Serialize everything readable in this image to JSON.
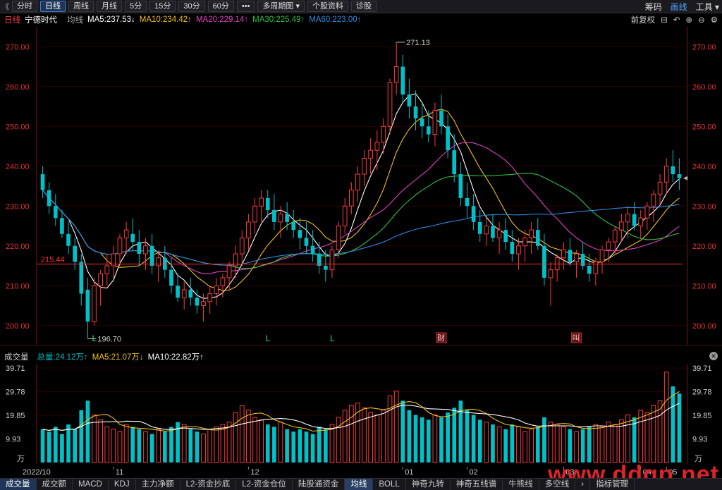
{
  "toolbar": {
    "back_glyph": "《",
    "buttons": [
      "分时",
      "日线",
      "周线",
      "月线",
      "5分",
      "15分",
      "30分",
      "60分",
      "•••",
      "多周期图 ▾",
      "个股资料",
      "诊股"
    ],
    "active_index": 1,
    "right": [
      "筹码",
      "画线",
      "工具 ▾"
    ]
  },
  "legend": {
    "period": "日线",
    "stock": "宁德时代",
    "avg_label": "均线",
    "ma5": "MA5:237.53↓",
    "ma10": "MA10:234.42↑",
    "ma20": "MA20:229.14↑",
    "ma30": "MA30:225.49↑",
    "ma60": "MA60:223.00↑",
    "adjust": "前复权"
  },
  "colors": {
    "up": "#ff3c3c",
    "down": "#00c0c8",
    "ma5": "#ffffff",
    "ma10": "#f0c020",
    "ma20": "#e040c0",
    "ma30": "#30c040",
    "ma60": "#2a8ae0",
    "axis_text": "#e63030",
    "grid": "#2a0000"
  },
  "price_axis": [
    "270.00",
    "260.00",
    "250.00",
    "240.00",
    "230.00",
    "220.00",
    "210.00",
    "200.00"
  ],
  "annotations": {
    "high": "271.13",
    "low": "196.70",
    "ref_line": "215.44",
    "markers": [
      "L",
      "L",
      "L"
    ],
    "finance_marker": "财",
    "q_marker": "叫"
  },
  "volume": {
    "label": "成交量",
    "total": "总量:24.12万↑",
    "ma5": "MA5:21.07万↓",
    "ma10": "MA10:22.82万↑",
    "axis": [
      "39.71",
      "29.78",
      "19.85",
      "9.93",
      "万"
    ]
  },
  "x_axis": [
    "2022/10",
    "11",
    "12",
    "01",
    "02",
    "03",
    "04",
    "05"
  ],
  "bottom_tabs": [
    "成交量",
    "成交额",
    "MACD",
    "KDJ",
    "主力净额",
    "L2-资金抄底",
    "L2-资金仓位",
    "陆股通资金",
    "均线",
    "BOLL",
    "神奇九转",
    "神奇五线谱",
    "牛熊线",
    "多空线",
    "›",
    "指标管理"
  ],
  "watermark": "www.ddgp.net",
  "chart_data": {
    "type": "candlestick",
    "title": "宁德时代 日线",
    "ylim": [
      195,
      275
    ],
    "candles": [
      [
        238,
        240,
        232,
        234
      ],
      [
        234,
        236,
        228,
        230
      ],
      [
        230,
        233,
        225,
        227
      ],
      [
        227,
        229,
        222,
        223
      ],
      [
        223,
        226,
        218,
        220
      ],
      [
        220,
        222,
        214,
        216
      ],
      [
        216,
        218,
        205,
        208
      ],
      [
        209,
        212,
        196.7,
        201
      ],
      [
        201,
        212,
        200,
        210
      ],
      [
        210,
        214,
        205,
        213
      ],
      [
        213,
        218,
        210,
        215
      ],
      [
        215,
        220,
        212,
        218
      ],
      [
        218,
        223,
        215,
        222
      ],
      [
        222,
        226,
        218,
        224
      ],
      [
        223,
        227,
        219,
        221
      ],
      [
        221,
        224,
        215,
        218
      ],
      [
        218,
        222,
        214,
        220
      ],
      [
        220,
        223,
        213,
        215
      ],
      [
        215,
        219,
        211,
        217
      ],
      [
        217,
        220,
        212,
        214
      ],
      [
        214,
        217,
        208,
        210
      ],
      [
        210,
        213,
        206,
        207
      ],
      [
        207,
        211,
        204,
        209
      ],
      [
        209,
        212,
        205,
        207
      ],
      [
        207,
        209,
        203,
        205
      ],
      [
        205,
        208,
        201,
        206
      ],
      [
        206,
        210,
        203,
        208
      ],
      [
        208,
        212,
        205,
        210
      ],
      [
        210,
        213,
        207,
        212
      ],
      [
        212,
        216,
        209,
        215
      ],
      [
        215,
        220,
        212,
        218
      ],
      [
        218,
        224,
        215,
        222
      ],
      [
        222,
        228,
        219,
        226
      ],
      [
        226,
        232,
        223,
        230
      ],
      [
        230,
        234,
        226,
        232
      ],
      [
        232,
        234,
        227,
        229
      ],
      [
        229,
        233,
        224,
        226
      ],
      [
        226,
        230,
        222,
        228
      ],
      [
        228,
        231,
        224,
        226
      ],
      [
        226,
        229,
        222,
        224
      ],
      [
        224,
        227,
        219,
        222
      ],
      [
        222,
        226,
        218,
        220
      ],
      [
        220,
        224,
        216,
        218
      ],
      [
        218,
        221,
        213,
        215
      ],
      [
        215,
        219,
        211,
        214
      ],
      [
        214,
        220,
        212,
        219
      ],
      [
        219,
        226,
        217,
        225
      ],
      [
        225,
        232,
        223,
        230
      ],
      [
        230,
        236,
        228,
        234
      ],
      [
        234,
        240,
        231,
        238
      ],
      [
        238,
        244,
        235,
        242
      ],
      [
        242,
        247,
        238,
        244
      ],
      [
        244,
        249,
        239,
        246
      ],
      [
        246,
        252,
        243,
        250
      ],
      [
        250,
        262,
        248,
        261
      ],
      [
        261,
        271.13,
        258,
        265
      ],
      [
        265,
        268,
        256,
        258
      ],
      [
        258,
        262,
        252,
        255
      ],
      [
        255,
        259,
        249,
        252
      ],
      [
        252,
        256,
        247,
        250
      ],
      [
        250,
        254,
        246,
        248
      ],
      [
        248,
        256,
        245,
        254
      ],
      [
        254,
        258,
        248,
        250
      ],
      [
        250,
        253,
        242,
        244
      ],
      [
        244,
        248,
        236,
        238
      ],
      [
        238,
        241,
        230,
        232
      ],
      [
        232,
        236,
        227,
        230
      ],
      [
        230,
        233,
        224,
        226
      ],
      [
        226,
        229,
        221,
        223
      ],
      [
        223,
        227,
        220,
        225
      ],
      [
        225,
        228,
        221,
        222
      ],
      [
        222,
        226,
        218,
        224
      ],
      [
        224,
        227,
        219,
        221
      ],
      [
        221,
        224,
        216,
        218
      ],
      [
        218,
        222,
        214,
        220
      ],
      [
        220,
        224,
        216,
        222
      ],
      [
        222,
        226,
        218,
        224
      ],
      [
        224,
        227,
        219,
        220
      ],
      [
        220,
        223,
        210,
        212
      ],
      [
        212,
        216,
        205,
        214
      ],
      [
        214,
        218,
        211,
        217
      ],
      [
        217,
        221,
        214,
        219
      ],
      [
        219,
        222,
        215,
        216
      ],
      [
        216,
        219,
        212,
        218
      ],
      [
        218,
        221,
        214,
        215
      ],
      [
        215,
        218,
        211,
        213
      ],
      [
        213,
        217,
        210,
        216
      ],
      [
        216,
        220,
        213,
        219
      ],
      [
        219,
        222,
        216,
        221
      ],
      [
        221,
        225,
        218,
        224
      ],
      [
        224,
        228,
        221,
        226
      ],
      [
        226,
        230,
        222,
        228
      ],
      [
        228,
        231,
        224,
        225
      ],
      [
        225,
        229,
        222,
        227
      ],
      [
        227,
        231,
        224,
        230
      ],
      [
        230,
        234,
        226,
        233
      ],
      [
        233,
        238,
        230,
        236
      ],
      [
        236,
        242,
        233,
        240
      ],
      [
        240,
        244,
        236,
        238
      ],
      [
        238,
        242,
        234,
        237
      ]
    ],
    "volume": [
      14,
      13,
      15,
      12,
      16,
      14,
      22,
      26,
      20,
      18,
      15,
      14,
      13,
      16,
      15,
      14,
      13,
      12,
      14,
      13,
      15,
      17,
      16,
      14,
      13,
      12,
      14,
      15,
      16,
      17,
      21,
      24,
      22,
      19,
      18,
      16,
      15,
      17,
      14,
      13,
      14,
      13,
      12,
      15,
      14,
      16,
      19,
      22,
      24,
      25,
      23,
      21,
      20,
      22,
      28,
      30,
      26,
      22,
      20,
      19,
      18,
      20,
      19,
      21,
      23,
      26,
      22,
      20,
      18,
      17,
      16,
      15,
      14,
      16,
      15,
      13,
      14,
      15,
      19,
      17,
      16,
      15,
      14,
      13,
      14,
      15,
      16,
      15,
      17,
      16,
      18,
      20,
      19,
      22,
      21,
      24,
      26,
      38,
      32,
      29
    ]
  }
}
